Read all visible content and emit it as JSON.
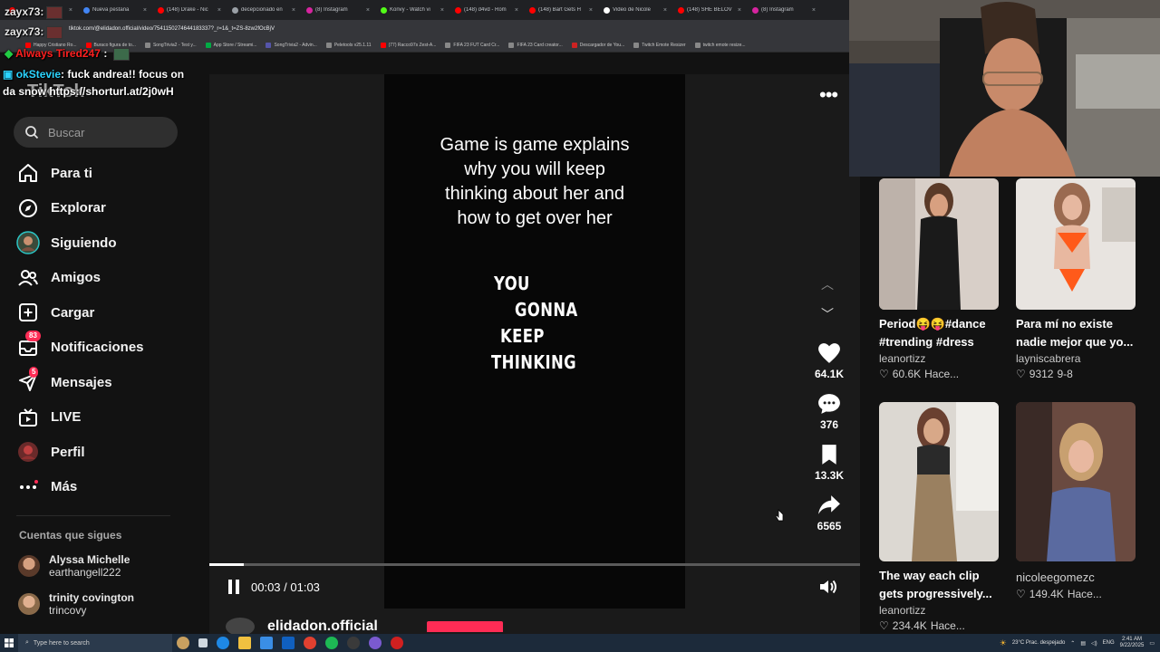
{
  "browser": {
    "tabs": [
      {
        "title": "",
        "color": "#ff0000"
      },
      {
        "title": "Nueva pestaña",
        "color": "#4285f4"
      },
      {
        "title": "(148) Drake - Nic",
        "color": "#ff0000"
      },
      {
        "title": "decepcionado en",
        "color": "#9aa0a6"
      },
      {
        "title": "(8) Instagram",
        "color": "#d6249f"
      },
      {
        "title": "Konvy - Watch vi",
        "color": "#53fc18"
      },
      {
        "title": "(148) d4vd - Rom",
        "color": "#ff0000"
      },
      {
        "title": "(148) Bart Gets H",
        "color": "#ff0000"
      },
      {
        "title": "Video de Nicole",
        "color": "#ffffff"
      },
      {
        "title": "(148) SHE BELOV",
        "color": "#ff0000"
      },
      {
        "title": "(8) Instagram",
        "color": "#d6249f"
      }
    ],
    "url": "tiktok.com/@elidadon.official/video/7541150274644183337?_r=1&_t=ZS-8zw2fOcBjV",
    "bookmarks": [
      {
        "label": "Happy Cristiano Ro...",
        "color": "#ff0000"
      },
      {
        "label": "Buraco figura de to...",
        "color": "#ff0000"
      },
      {
        "label": "SongTrivia2 - Test y...",
        "color": "#888888"
      },
      {
        "label": "App Store / Streami...",
        "color": "#00aa44"
      },
      {
        "label": "SongTrivia2 - Advin...",
        "color": "#5555aa"
      },
      {
        "label": "Peletools v25.1.11",
        "color": "#888888"
      },
      {
        "label": "(77) Racco97s Zest-A...",
        "color": "#ff0000"
      },
      {
        "label": "FIFA 23 FUT Card Cr...",
        "color": "#888888"
      },
      {
        "label": "FIFA 23 Card creator...",
        "color": "#888888"
      },
      {
        "label": "Descargador de You...",
        "color": "#cc2222"
      },
      {
        "label": "Twitch Emote Resizer",
        "color": "#888888"
      },
      {
        "label": "twitch emote resize...",
        "color": "#888888"
      }
    ]
  },
  "chat": {
    "line1_user": "zayx73",
    "line2_user": "zayx73",
    "line3_user": "Always Tired247",
    "line4_user": "okStevie",
    "line4_text": ": fuck andrea!! focus on",
    "line5_text": "da snow https://shorturl.at/2j0wH",
    "line_suffix": ":"
  },
  "sidebar": {
    "logo": "TikTok",
    "search_placeholder": "Buscar",
    "items": [
      {
        "label": "Para ti"
      },
      {
        "label": "Explorar"
      },
      {
        "label": "Siguiendo"
      },
      {
        "label": "Amigos"
      },
      {
        "label": "Cargar"
      },
      {
        "label": "Notificaciones",
        "badge": "83"
      },
      {
        "label": "Mensajes",
        "badge": "5"
      },
      {
        "label": "LIVE"
      },
      {
        "label": "Perfil"
      },
      {
        "label": "Más"
      }
    ],
    "following_title": "Cuentas que sigues",
    "accounts": [
      {
        "name": "Alyssa Michelle",
        "handle": "earthangell222"
      },
      {
        "name": "trinity covington",
        "handle": "trincovy"
      }
    ]
  },
  "video": {
    "caption": [
      "Game is game explains",
      "why you will keep",
      "thinking about her and",
      "how to get over her"
    ],
    "big_words": [
      "YOU",
      "GONNA",
      "KEEP",
      "THINKING"
    ],
    "likes": "64.1K",
    "comments": "376",
    "saves": "13.3K",
    "shares": "6565",
    "time": "00:03 / 01:03",
    "progress": 0.053,
    "author": "elidadon.official"
  },
  "recommendations": [
    {
      "title": "Period😝😝#dance #trending #dress",
      "user": "leanortizz",
      "likes": "60.6K",
      "date": "Hace..."
    },
    {
      "title": "Para mí no existe nadie mejor que yo...",
      "user": "layniscabrera",
      "likes": "9312",
      "date": "9-8"
    },
    {
      "title": "The way each clip gets progressively...",
      "user": "leanortizz",
      "likes": "234.4K",
      "date": "Hace..."
    },
    {
      "title": "",
      "user": "nicoleegomezc",
      "likes": "149.4K",
      "date": "Hace..."
    }
  ],
  "taskbar": {
    "search": "Type here to search",
    "weather": "23°C  Prac. despejado",
    "lang": "ENG",
    "time": "2:41 AM",
    "date": "9/22/2025"
  }
}
